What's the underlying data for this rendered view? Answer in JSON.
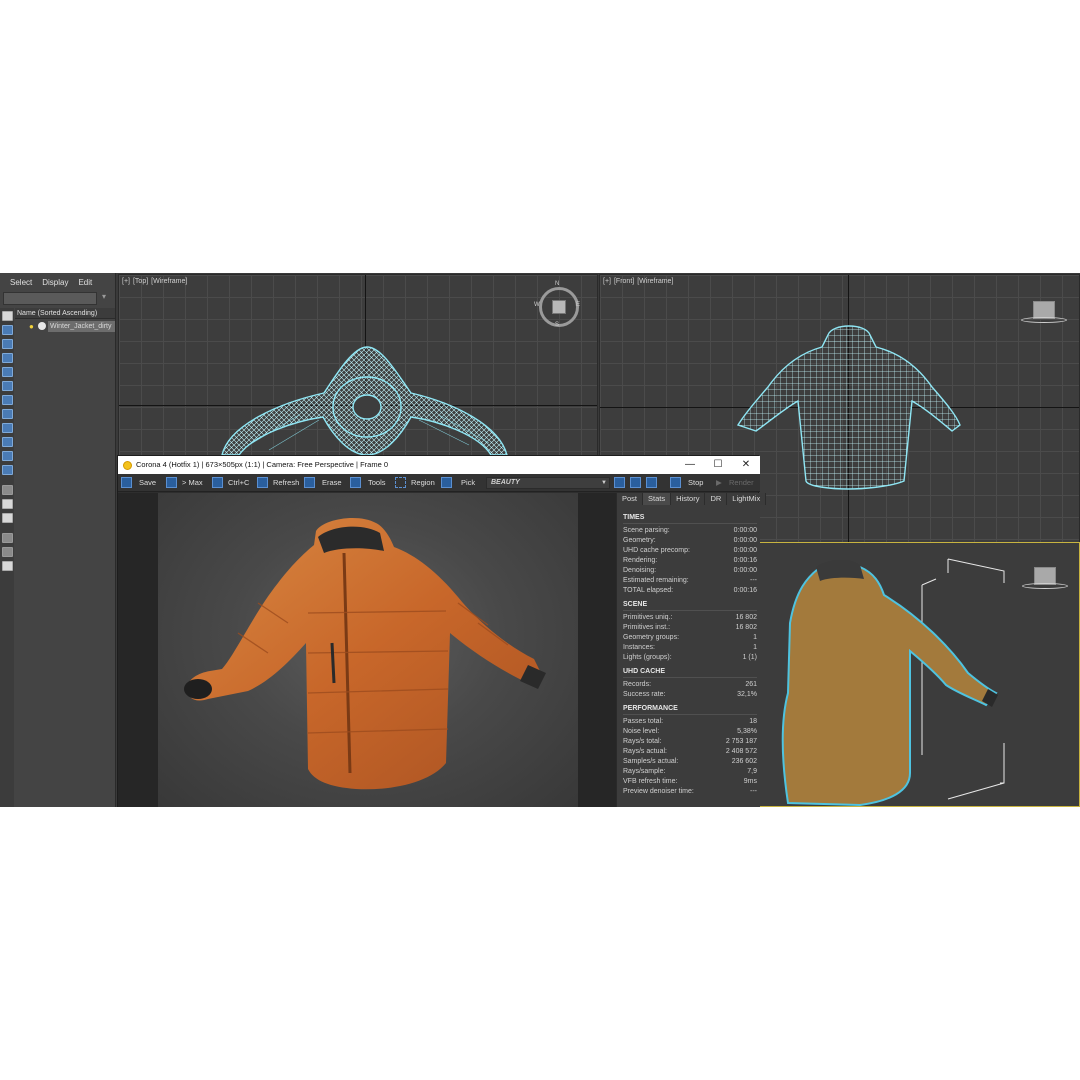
{
  "explorer": {
    "menu": [
      "Select",
      "Display",
      "Edit"
    ],
    "column_header": "Name (Sorted Ascending)",
    "object_name": "Winter_Jacket_dirty"
  },
  "viewports": {
    "top": [
      "[+]",
      "[Top]",
      "[Wireframe]"
    ],
    "front": [
      "[+]",
      "[Front]",
      "[Wireframe]"
    ],
    "compass": {
      "n": "N",
      "s": "S",
      "w": "W",
      "e": "E"
    }
  },
  "vfb": {
    "title": "Corona 4 (Hotfix 1) | 673×505px (1:1) | Camera: Free Perspective | Frame 0",
    "window_controls": {
      "minimize": "—",
      "maximize": "☐",
      "close": "✕"
    },
    "toolbar": {
      "save": "Save",
      "max": "> Max",
      "ctrl_c": "Ctrl+C",
      "refresh": "Refresh",
      "erase": "Erase",
      "tools": "Tools",
      "region": "Region",
      "pick": "Pick",
      "pass": "BEAUTY",
      "stop": "Stop",
      "render": "Render"
    },
    "tabs": [
      "Post",
      "Stats",
      "History",
      "DR",
      "LightMix"
    ],
    "active_tab": "Stats",
    "stats": {
      "times_title": "TIMES",
      "times": [
        {
          "k": "Scene parsing:",
          "v": "0:00:00"
        },
        {
          "k": "Geometry:",
          "v": "0:00:00"
        },
        {
          "k": "UHD cache precomp:",
          "v": "0:00:00"
        },
        {
          "k": "Rendering:",
          "v": "0:00:16"
        },
        {
          "k": "Denoising:",
          "v": "0:00:00"
        },
        {
          "k": "Estimated remaining:",
          "v": "---"
        },
        {
          "k": "TOTAL elapsed:",
          "v": "0:00:16"
        }
      ],
      "scene_title": "SCENE",
      "scene": [
        {
          "k": "Primitives uniq.:",
          "v": "16 802"
        },
        {
          "k": "Primitives inst.:",
          "v": "16 802"
        },
        {
          "k": "Geometry groups:",
          "v": "1"
        },
        {
          "k": "Instances:",
          "v": "1"
        },
        {
          "k": "Lights (groups):",
          "v": "1 (1)"
        }
      ],
      "uhd_title": "UHD CACHE",
      "uhd": [
        {
          "k": "Records:",
          "v": "261"
        },
        {
          "k": "Success rate:",
          "v": "32,1%"
        }
      ],
      "perf_title": "PERFORMANCE",
      "perf": [
        {
          "k": "Passes total:",
          "v": "18"
        },
        {
          "k": "Noise level:",
          "v": "5,38%"
        },
        {
          "k": "Rays/s total:",
          "v": "2 753 187"
        },
        {
          "k": "Rays/s actual:",
          "v": "2 408 572"
        },
        {
          "k": "Samples/s actual:",
          "v": "236 602"
        },
        {
          "k": "Rays/sample:",
          "v": "7,9"
        },
        {
          "k": "VFB refresh time:",
          "v": "9ms"
        },
        {
          "k": "Preview denoiser time:",
          "v": "---"
        }
      ]
    }
  },
  "colors": {
    "wireframe": "#8fe6f4",
    "jacket_orange": "#c86a2a",
    "jacket_tan": "#a37a3c",
    "selection_yellow": "#c8b440",
    "accent_blue": "#2a5f9e"
  }
}
